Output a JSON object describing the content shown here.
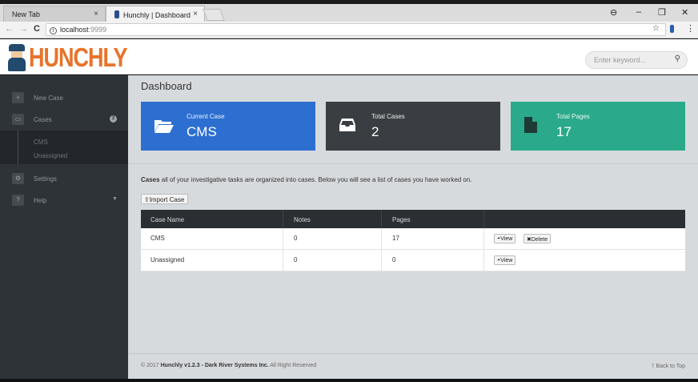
{
  "browser": {
    "tabs": [
      {
        "label": "New Tab"
      },
      {
        "label": "Hunchly | Dashboard"
      }
    ],
    "close_glyph": "×",
    "address": {
      "host": "localhost",
      "port": ":9999"
    },
    "win": {
      "profile": "⊖",
      "min": "–",
      "restore": "❐",
      "close": "✕"
    }
  },
  "app": {
    "logo_text": "HUNCHLY",
    "search_placeholder": "Enter keyword..."
  },
  "sidebar": {
    "items": [
      {
        "label": "New Case",
        "icon": "plus-icon"
      },
      {
        "label": "Cases",
        "icon": "folder-icon",
        "badge": "2"
      },
      {
        "label": "Settings",
        "icon": "gear-icon"
      },
      {
        "label": "Help",
        "icon": "help-icon"
      }
    ],
    "sub_items": [
      {
        "label": "CMS"
      },
      {
        "label": "Unassigned"
      }
    ]
  },
  "main": {
    "title": "Dashboard",
    "cards": [
      {
        "label": "Current Case",
        "value": "CMS",
        "color": "#2d6fd0"
      },
      {
        "label": "Total Cases",
        "value": "2",
        "color": "#3a3e43"
      },
      {
        "label": "Total Pages",
        "value": "17",
        "color": "#2aaa8a"
      }
    ],
    "intro_bold": "Cases",
    "intro_rest": " all of your investigative tasks are organized into cases. Below you will see a list of cases you have worked on.",
    "import_label": "Import Case",
    "table": {
      "headers": [
        "Case Name",
        "Notes",
        "Pages",
        ""
      ],
      "rows": [
        {
          "name": "CMS",
          "notes": "0",
          "pages": "17",
          "view": "View",
          "delete": "Delete"
        },
        {
          "name": "Unassigned",
          "notes": "0",
          "pages": "0",
          "view": "View"
        }
      ]
    }
  },
  "footer": {
    "copyright_prefix": "© 2017 ",
    "product": "Hunchly v1.2.3 - Dark River Systems Inc.",
    "rights": " All Right Reserved",
    "back_to_top": "Back to Top"
  }
}
